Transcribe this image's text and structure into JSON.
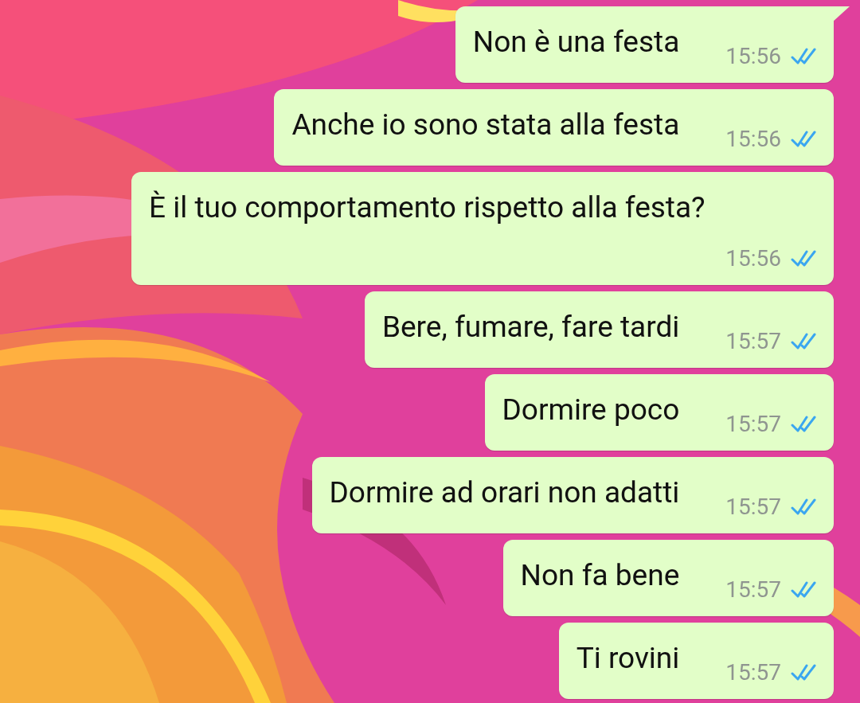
{
  "messages": [
    {
      "text": "Non è una festa",
      "time": "15:56",
      "read": true,
      "tail": true
    },
    {
      "text": "Anche io sono stata alla festa",
      "time": "15:56",
      "read": true,
      "tail": false
    },
    {
      "text": "È il tuo comportamento rispetto alla festa?",
      "time": "15:56",
      "read": true,
      "tail": false
    },
    {
      "text": "Bere, fumare, fare tardi",
      "time": "15:57",
      "read": true,
      "tail": false
    },
    {
      "text": "Dormire poco",
      "time": "15:57",
      "read": true,
      "tail": false
    },
    {
      "text": "Dormire ad orari non adatti",
      "time": "15:57",
      "read": true,
      "tail": false
    },
    {
      "text": "Non fa bene",
      "time": "15:57",
      "read": true,
      "tail": false
    },
    {
      "text": "Ti rovini",
      "time": "15:57",
      "read": true,
      "tail": false
    }
  ]
}
